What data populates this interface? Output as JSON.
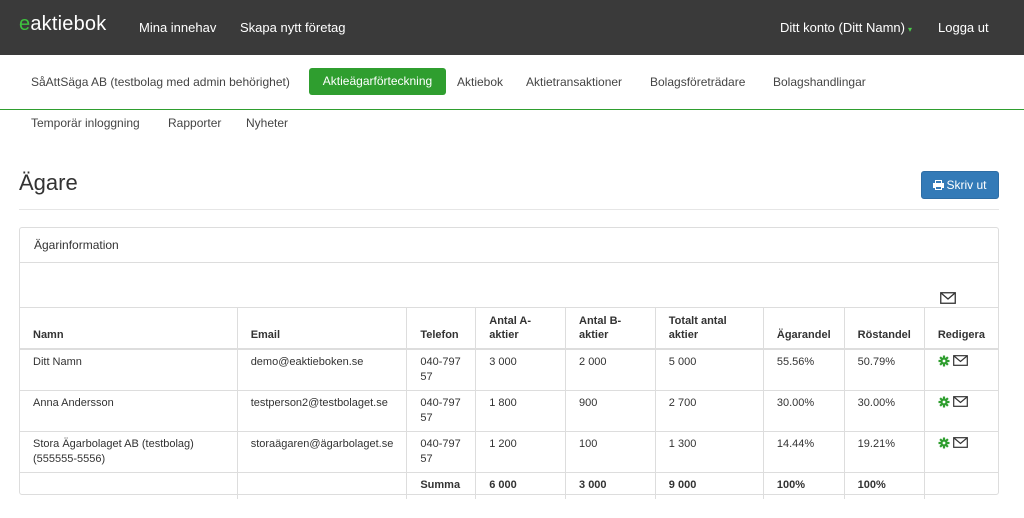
{
  "header": {
    "logo_e": "e",
    "logo_rest": "aktiebok",
    "nav": [
      "Mina innehav",
      "Skapa nytt företag"
    ],
    "account": "Ditt konto (Ditt Namn)",
    "logout": "Logga ut"
  },
  "subnav": {
    "company": "SåAttSäga AB (testbolag med admin behörighet)",
    "active": "Aktieägarförteckning",
    "items": [
      "Aktiebok",
      "Aktietransaktioner",
      "Bolagsföreträdare",
      "Bolagshandlingar"
    ],
    "items2": [
      "Temporär inloggning",
      "Rapporter",
      "Nyheter"
    ]
  },
  "page": {
    "title": "Ägare",
    "print_label": "Skriv ut"
  },
  "panel": {
    "heading": "Ägarinformation"
  },
  "table": {
    "headers": [
      "Namn",
      "Email",
      "Telefon",
      "Antal A-aktier",
      "Antal B-aktier",
      "Totalt antal aktier",
      "Ägarandel",
      "Röstandel",
      "Redigera"
    ],
    "rows": [
      [
        "Ditt Namn",
        "demo@eaktieboken.se",
        "040-797 57",
        "3 000",
        "2 000",
        "5 000",
        "55.56%",
        "50.79%"
      ],
      [
        "Anna Andersson",
        "testperson2@testbolaget.se",
        "040-797 57",
        "1 800",
        "900",
        "2 700",
        "30.00%",
        "30.00%"
      ],
      [
        "Stora Ägarbolaget AB (testbolag) (555555-5556)",
        "storaägaren@ägarbolaget.se",
        "040-797 57",
        "1 200",
        "100",
        "1 300",
        "14.44%",
        "19.21%"
      ]
    ],
    "sum": [
      "Summa",
      "6 000",
      "3 000",
      "9 000",
      "100%",
      "100%"
    ]
  },
  "colors": {
    "brand_green": "#2f9e2f",
    "topbar": "#3a3a3a",
    "print_blue": "#337ab7"
  },
  "icons": [
    "print-icon",
    "envelope-icon",
    "gear-icon",
    "caret-down-icon"
  ]
}
